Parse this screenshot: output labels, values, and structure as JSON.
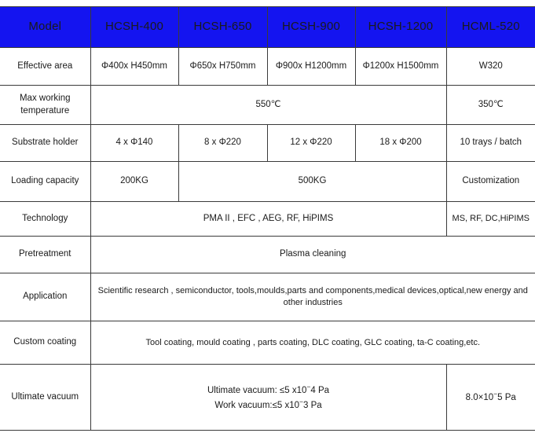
{
  "table": {
    "header": {
      "row_label": "Model",
      "columns": [
        "HCSH-400",
        "HCSH-650",
        "HCSH-900",
        "HCSH-1200",
        "HCML-520"
      ]
    },
    "rows": [
      {
        "label": "Effective area",
        "cells": [
          "Φ400x H450mm",
          "Φ650x H750mm",
          "Φ900x H1200mm",
          "Φ1200x H1500mm",
          "W320"
        ]
      },
      {
        "label": "Max working temperature",
        "label_line1": "Max working",
        "label_line2": "temperature",
        "merged_value": "550℃",
        "last_value": "350℃"
      },
      {
        "label": "Substrate holder",
        "cells": [
          "4 x Φ140",
          "8 x Φ220",
          "12 x Φ220",
          "18 x Φ200",
          "10 trays / batch"
        ]
      },
      {
        "label": "Loading capacity",
        "first_value": "200KG",
        "merged_value": "500KG",
        "last_value": "Customization"
      },
      {
        "label": "Technology",
        "merged_value": "PMA II , EFC , AEG, RF, HiPIMS",
        "last_value": "MS, RF, DC,HiPIMS"
      },
      {
        "label": "Pretreatment",
        "merged_value": "Plasma cleaning"
      },
      {
        "label": "Application",
        "merged_value": "Scientific research , semiconductor, tools,moulds,parts and components,medical devices,optical,new energy and other industries"
      },
      {
        "label": "Custom coating",
        "merged_value": "Tool coating, mould coating , parts coating, DLC coating, GLC coating, ta-C coating,etc."
      },
      {
        "label": "Ultimate vacuum",
        "vacuum_line1_prefix": "Ultimate vacuum: ≤5 x10",
        "vacuum_line1_exp": "−",
        "vacuum_line1_suffix": "4 Pa",
        "vacuum_line2_prefix": "Work vacuum:≤5 x10",
        "vacuum_line2_exp": "−",
        "vacuum_line2_suffix": "3 Pa",
        "last_prefix": "8.0×10",
        "last_exp": "−",
        "last_suffix": "5 Pa"
      }
    ]
  },
  "colors": {
    "header_blue": "#1414f0",
    "header_text": "#ffffff",
    "border": "#3a3a3a",
    "text": "#1a1a1a",
    "background": "#ffffff"
  }
}
